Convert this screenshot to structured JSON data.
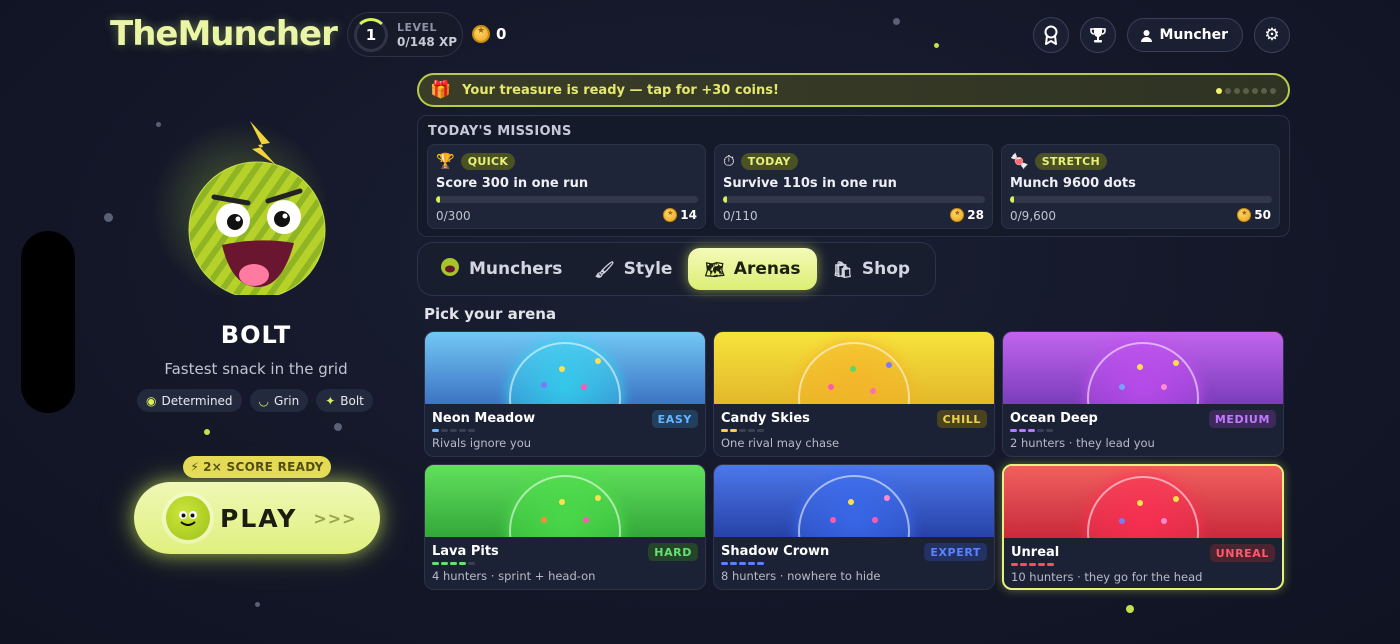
{
  "header": {
    "logo": "TheMuncher",
    "level_number": "1",
    "level_label": "LEVEL",
    "xp": "0/148 XP",
    "coins": "0",
    "user_label": "Muncher"
  },
  "character": {
    "name": "BOLT",
    "tagline": "Fastest snack in the grid",
    "traits": [
      {
        "icon": "eye-icon",
        "label": "Determined"
      },
      {
        "icon": "mouth-icon",
        "label": "Grin"
      },
      {
        "icon": "sparkle-icon",
        "label": "Bolt"
      }
    ],
    "score_badge": "2× SCORE READY",
    "play_label": "PLAY",
    "play_arrows": ">>>"
  },
  "treasure": {
    "text": "Your treasure is ready — tap for +30 coins!",
    "pages": 7,
    "active_page": 0
  },
  "missions": {
    "title": "TODAY'S MISSIONS",
    "items": [
      {
        "icon": "trophy-icon",
        "tag": "QUICK",
        "title": "Score 300 in one run",
        "progress": "0/300",
        "fraction": 0.0,
        "reward": "14"
      },
      {
        "icon": "stopwatch-icon",
        "tag": "TODAY",
        "title": "Survive 110s in one run",
        "progress": "0/110",
        "fraction": 0.0,
        "reward": "28"
      },
      {
        "icon": "candy-icon",
        "tag": "STRETCH",
        "title": "Munch 9600 dots",
        "progress": "0/9,600",
        "fraction": 0.0,
        "reward": "50"
      }
    ]
  },
  "tabs": [
    {
      "icon": "muncher-face-icon",
      "label": "Munchers",
      "active": false
    },
    {
      "icon": "brush-icon",
      "label": "Style",
      "active": false
    },
    {
      "icon": "map-icon",
      "label": "Arenas",
      "active": true
    },
    {
      "icon": "shopping-bag-icon",
      "label": "Shop",
      "active": false
    }
  ],
  "arenas": {
    "title": "Pick your arena",
    "items": [
      {
        "name": "Neon Meadow",
        "difficulty": "EASY",
        "desc": "Rivals ignore you",
        "level": 1,
        "top": "#72c8f4",
        "bottom": "#3d73c4",
        "dome": "#2fd8f0",
        "badge_bg": "#233f5e",
        "badge_fg": "#64b6ff",
        "dot": "#64b6ff",
        "selected": false
      },
      {
        "name": "Candy Skies",
        "difficulty": "CHILL",
        "desc": "One rival may chase",
        "level": 2,
        "top": "#f7e33d",
        "bottom": "#e3b82a",
        "dome": "#f5b228",
        "badge_bg": "#4b4320",
        "badge_fg": "#f0d34a",
        "dot": "#f0d34a",
        "selected": false
      },
      {
        "name": "Ocean Deep",
        "difficulty": "MEDIUM",
        "desc": "2 hunters · they lead you",
        "level": 3,
        "top": "#c364ee",
        "bottom": "#7a3dbb",
        "dome": "#c24cf2",
        "badge_bg": "#3e2a5a",
        "badge_fg": "#c07aff",
        "dot": "#b47aff",
        "selected": false
      },
      {
        "name": "Lava Pits",
        "difficulty": "HARD",
        "desc": "4 hunters · sprint + head-on",
        "level": 4,
        "top": "#62e05c",
        "bottom": "#33a83a",
        "dome": "#4ce04a",
        "badge_bg": "#25452a",
        "badge_fg": "#66e070",
        "dot": "#66e070",
        "selected": false
      },
      {
        "name": "Shadow Crown",
        "difficulty": "EXPERT",
        "desc": "8 hunters · nowhere to hide",
        "level": 5,
        "top": "#4d78ea",
        "bottom": "#2742a8",
        "dome": "#3a6cf2",
        "badge_bg": "#243263",
        "badge_fg": "#5a82ff",
        "dot": "#5a82ff",
        "selected": false
      },
      {
        "name": "Unreal",
        "difficulty": "UNREAL",
        "desc": "10 hunters · they go for the head",
        "level": 6,
        "top": "#f06060",
        "bottom": "#c92a3a",
        "dome": "#ff2d55",
        "badge_bg": "#4a2430",
        "badge_fg": "#ff5a6e",
        "dot": "#ff4d62",
        "selected": true
      }
    ]
  }
}
